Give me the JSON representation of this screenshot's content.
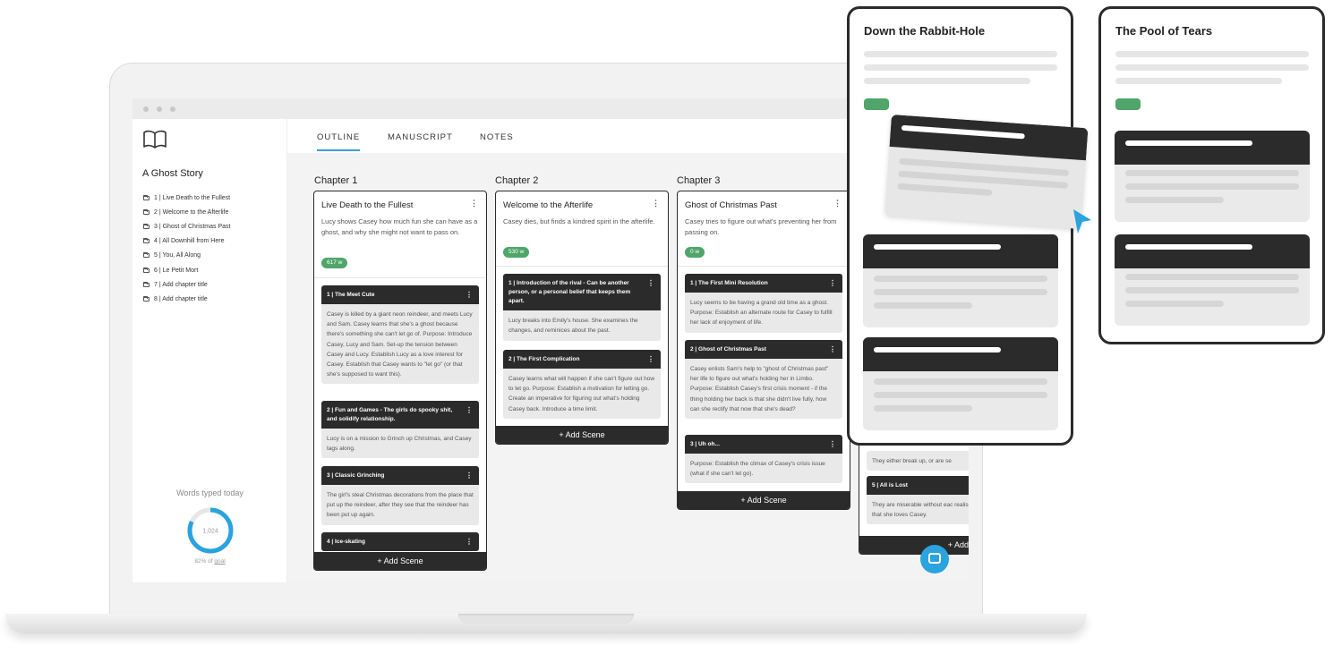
{
  "app": {
    "story_title": "A Ghost Story"
  },
  "tabs": [
    {
      "label": "OUTLINE",
      "active": true
    },
    {
      "label": "MANUSCRIPT"
    },
    {
      "label": "NOTES"
    }
  ],
  "sidebar": {
    "chapters": [
      "1 | Live Death to the Fullest",
      "2 | Welcome to the Afterlife",
      "3 | Ghost of Christmas Past",
      "4 | All Downhill from Here",
      "5 | You, All Along",
      "6 | Le Petit Mort",
      "7 | Add chapter title",
      "8 | Add chapter title"
    ],
    "words_label": "Words typed today",
    "words_count": "1,024",
    "goal_pct": "82%",
    "goal_text": "of",
    "goal_link": "goal",
    "goal_fraction": 0.82
  },
  "chapters": [
    {
      "heading": "Chapter 1",
      "title": "Live Death to the Fullest",
      "desc": "Lucy shows Casey how much fun she can have as a ghost, and why she might not want to pass on.",
      "words": "617 w",
      "scenes": [
        {
          "title": "1 | The Meet Cute",
          "body": "Casey is killed by a giant neon reindeer, and meets Lucy and Sam. Casey learns that she's a ghost because there's something she can't let go of. Purpose: Introduce Casey, Lucy and Sam. Set-up the tension between Casey and Lucy. Establish Lucy as a love interest for Casey. Establish that Casey wants to \"let go\" (or that she's supposed to want this)."
        },
        {
          "title": "2 | Fun and Games - The girls do spooky shit, and solidify relationship.",
          "body": "Lucy is on a mission to Grinch up Christmas, and Casey tags along."
        },
        {
          "title": "3 | Classic Grinching",
          "body": "The girl's steal Christmas decorations from the place that put up the reindeer, after they see that the reindeer has been put up again."
        },
        {
          "title": "4 | Ice-skating",
          "body": ""
        }
      ]
    },
    {
      "heading": "Chapter 2",
      "title": "Welcome to the Afterlife",
      "desc": "Casey dies, but finds a kindred spirit in the afterlife.",
      "words": "530 w",
      "scenes": [
        {
          "title": "1 | Introduction of the rival - Can be another person, or a personal belief that keeps them apart.",
          "body": "Lucy breaks into Emily's house. She examines the changes, and reminices about the past."
        },
        {
          "title": "2 | The First Complication",
          "body": "Casey learns what will happen if she can't figure out how to let go. Purpose: Establish a motivation for letting go. Create an imperative for figuring out what's holding Casey back. Introduce a time limit."
        }
      ]
    },
    {
      "heading": "Chapter 3",
      "title": "Ghost of Christmas Past",
      "desc": "Casey tries to figure out what's preventing her from passing on.",
      "words": "0 w",
      "scenes": [
        {
          "title": "1 | The First Mini Resolution",
          "body": "Lucy seems to be having a grand old time as a ghost. Purpose: Establish an alternate route for Casey to fulfill her lack of enjoyment of life."
        },
        {
          "title": "2 | Ghost of Christmas Past",
          "body": "Casey enlists Sam's help to \"ghost of Christmas past\" her life to figure out what's holding her in Limbo. Purpose: Establish Casey's first crisis moment - if the thing holding her back is that she didn't live fully, how can she rectify that now that she's dead?"
        },
        {
          "title": "3 | Uh oh...",
          "body": "Purpose: Establish the climax of Casey's crisis issue (what if she can't let go)."
        }
      ]
    },
    {
      "scenes": [
        {
          "body": "They either break up, or are se"
        },
        {
          "title": "5 | All is Lost",
          "body": "They are miserable without eac realises that she loves Casey."
        }
      ]
    }
  ],
  "add_scene_label": "+ Add Scene",
  "add_scene_partial": "+ Add Sce",
  "preview_cards": [
    {
      "title": "Down the Rabbit-Hole"
    },
    {
      "title": "The Pool of Tears"
    }
  ],
  "colors": {
    "accent": "#3a9fd6",
    "word_pill": "#4fa56a",
    "dark": "#2b2b2b",
    "chat": "#2aa3de"
  }
}
